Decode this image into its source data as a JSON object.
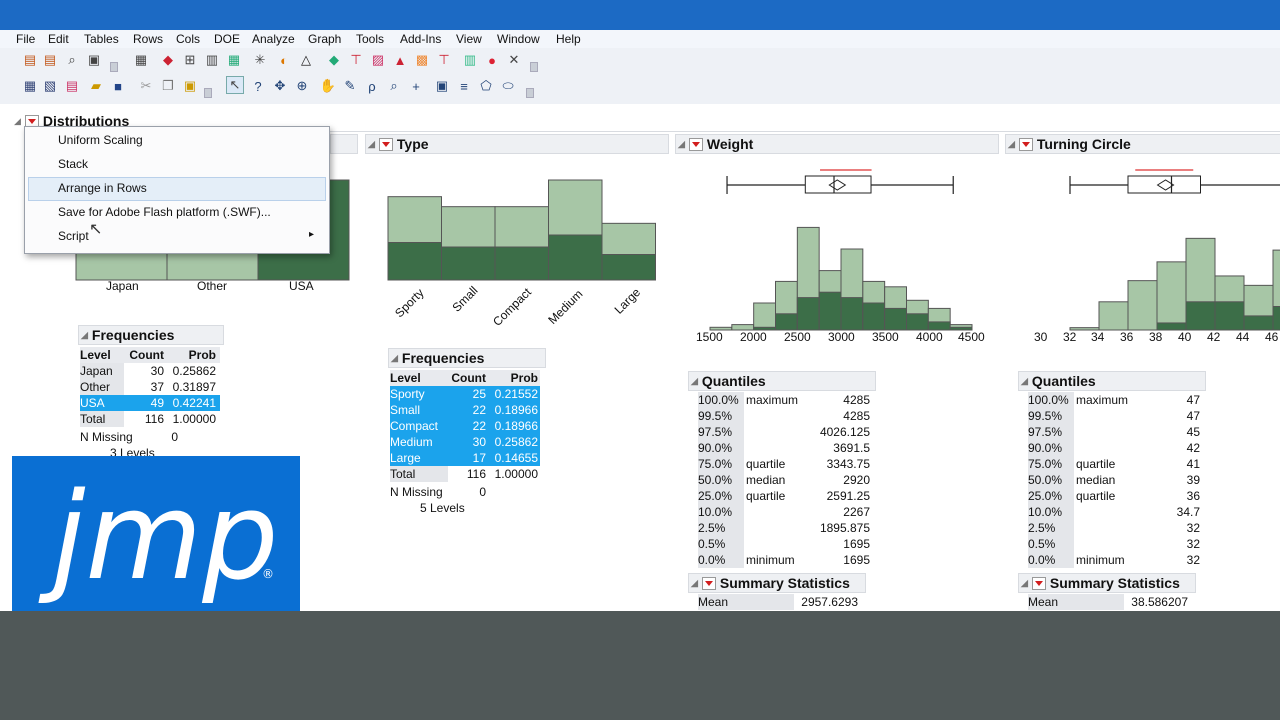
{
  "menu": [
    "File",
    "Edit",
    "Tables",
    "Rows",
    "Cols",
    "DOE",
    "Analyze",
    "Graph",
    "Tools",
    "Add-Ins",
    "View",
    "Window",
    "Help"
  ],
  "colors": {
    "titlebar": "#1c6ac4",
    "bar_fill": "#a7c6a6",
    "bar_dark": "#3c6e48",
    "selection": "#1ba3ec",
    "logo_bg": "#0a6fd3",
    "bottom_band": "#505858"
  },
  "distributions": {
    "title": "Distributions"
  },
  "popup_menu": {
    "items": [
      "Uniform Scaling",
      "Stack",
      "Arrange in Rows",
      "Save for Adobe Flash platform (.SWF)...",
      "Script"
    ],
    "highlighted": "Arrange in Rows",
    "submenu_arrow": "▸"
  },
  "country": {
    "x_ticks": [
      "Japan",
      "Other",
      "USA"
    ],
    "freq_title": "Frequencies",
    "headers": [
      "Level",
      "Count",
      "Prob"
    ],
    "rows": [
      [
        "Japan",
        "30",
        "0.25862"
      ],
      [
        "Other",
        "37",
        "0.31897"
      ],
      [
        "USA",
        "49",
        "0.42241"
      ]
    ],
    "total": [
      "Total",
      "116",
      "1.00000"
    ],
    "n_missing_label": "N Missing",
    "n_missing": "0",
    "levels": "3  Levels"
  },
  "type": {
    "title": "Type",
    "x_ticks": [
      "Sporty",
      "Small",
      "Compact",
      "Medium",
      "Large"
    ],
    "freq_title": "Frequencies",
    "headers": [
      "Level",
      "Count",
      "Prob"
    ],
    "rows": [
      [
        "Sporty",
        "25",
        "0.21552"
      ],
      [
        "Small",
        "22",
        "0.18966"
      ],
      [
        "Compact",
        "22",
        "0.18966"
      ],
      [
        "Medium",
        "30",
        "0.25862"
      ],
      [
        "Large",
        "17",
        "0.14655"
      ]
    ],
    "total": [
      "Total",
      "116",
      "1.00000"
    ],
    "n_missing_label": "N Missing",
    "n_missing": "0",
    "levels": "5  Levels"
  },
  "weight": {
    "title": "Weight",
    "x_ticks": [
      "1500",
      "2000",
      "2500",
      "3000",
      "3500",
      "4000",
      "4500"
    ],
    "quantiles_title": "Quantiles",
    "quantiles": [
      [
        "100.0%",
        "maximum",
        "4285"
      ],
      [
        "99.5%",
        "",
        "4285"
      ],
      [
        "97.5%",
        "",
        "4026.125"
      ],
      [
        "90.0%",
        "",
        "3691.5"
      ],
      [
        "75.0%",
        "quartile",
        "3343.75"
      ],
      [
        "50.0%",
        "median",
        "2920"
      ],
      [
        "25.0%",
        "quartile",
        "2591.25"
      ],
      [
        "10.0%",
        "",
        "2267"
      ],
      [
        "2.5%",
        "",
        "1895.875"
      ],
      [
        "0.5%",
        "",
        "1695"
      ],
      [
        "0.0%",
        "minimum",
        "1695"
      ]
    ],
    "summary_title": "Summary Statistics",
    "mean_label": "Mean",
    "mean": "2957.6293"
  },
  "turning": {
    "title": "Turning Circle",
    "x_ticks": [
      "30",
      "32",
      "34",
      "36",
      "38",
      "40",
      "42",
      "44",
      "46"
    ],
    "quantiles_title": "Quantiles",
    "quantiles": [
      [
        "100.0%",
        "maximum",
        "47"
      ],
      [
        "99.5%",
        "",
        "47"
      ],
      [
        "97.5%",
        "",
        "45"
      ],
      [
        "90.0%",
        "",
        "42"
      ],
      [
        "75.0%",
        "quartile",
        "41"
      ],
      [
        "50.0%",
        "median",
        "39"
      ],
      [
        "25.0%",
        "quartile",
        "36"
      ],
      [
        "10.0%",
        "",
        "34.7"
      ],
      [
        "2.5%",
        "",
        "32"
      ],
      [
        "0.5%",
        "",
        "32"
      ],
      [
        "0.0%",
        "minimum",
        "32"
      ]
    ],
    "summary_title": "Summary Statistics",
    "mean_label": "Mean",
    "mean": "38.586207"
  },
  "logo": {
    "text": "jmp",
    "mark": "®"
  }
}
